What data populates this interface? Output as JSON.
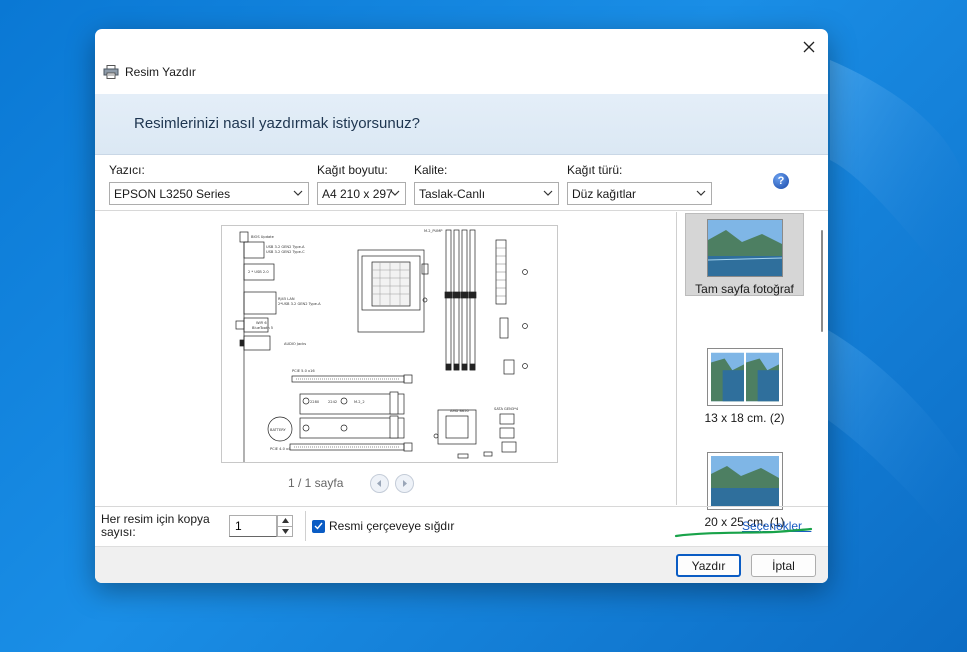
{
  "dialog": {
    "title": "Resim Yazdır",
    "heading": "Resimlerinizi nasıl yazdırmak istiyorsunuz?"
  },
  "printer": {
    "label": "Yazıcı:",
    "value": "EPSON L3250 Series"
  },
  "paper_size": {
    "label": "Kağıt boyutu:",
    "value": "A4 210 x 297"
  },
  "quality": {
    "label": "Kalite:",
    "value": "Taslak-Canlı"
  },
  "paper_type": {
    "label": "Kağıt türü:",
    "value": "Düz kağıtlar"
  },
  "preview": {
    "pager": "1 / 1 sayfa"
  },
  "layouts": [
    {
      "label": "Tam sayfa fotoğraf",
      "selected": true
    },
    {
      "label": "13 x 18 cm. (2)",
      "selected": false
    },
    {
      "label": "20 x 25 cm. (1)",
      "selected": false
    }
  ],
  "copies": {
    "label": "Her resim için kopya sayısı:",
    "value": "1"
  },
  "fit_frame": {
    "label": "Resmi çerçeveye sığdır",
    "checked": true
  },
  "options_link": "Seçenekler...",
  "buttons": {
    "print": "Yazdır",
    "cancel": "İptal"
  },
  "motherboard_labels": {
    "bios": "BIOS Update",
    "usb1": "USB 3.2 GEN2 Type-A",
    "usb2": "USB 3.2 GEN2 Type-C",
    "usb3": "2 * USB 2.0",
    "lan": "RJ45 LAN",
    "usb4": "2*USB 3.2 GEN2 Type-A",
    "wifi": "WiFi 6",
    "bt": "BlueTooth 5",
    "audio": "AUDIO Jacks",
    "pump": "M.2_PUMP",
    "pcie1": "PCIE 5.0 x16",
    "pcie2": "PCIE 4.0 x4",
    "m2a": "2280",
    "m2b": "2242",
    "m2c": "M.2_2",
    "battery": "BATTERY",
    "sata": "SATA GEN3*4",
    "chip": "AMD B650",
    "atx": "ATXPWR",
    "cpu": "CPU8PIN"
  }
}
